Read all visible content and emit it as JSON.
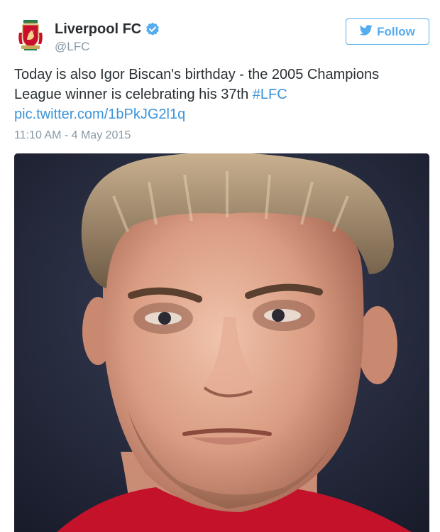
{
  "account": {
    "display_name": "Liverpool FC",
    "handle": "@LFC",
    "verified": true,
    "avatar_icon": "liverpool-crest-icon"
  },
  "follow_button": {
    "label": "Follow",
    "icon": "twitter-bird-icon",
    "color": "#55acee"
  },
  "tweet": {
    "text_part1": "Today is also Igor Biscan's birthday - the 2005 Champions League winner is celebrating his 37th ",
    "hashtag": "#LFC",
    "link": "pic.twitter.com/1bPkJG2l1q",
    "timestamp": "11:10 AM - 4 May 2015"
  },
  "colors": {
    "link": "#3b94d9",
    "muted": "#8899a6",
    "text": "#292f33",
    "verified": "#55acee",
    "crest_red": "#c8102e"
  },
  "media": {
    "type": "photo",
    "subject": "portrait-photo"
  }
}
